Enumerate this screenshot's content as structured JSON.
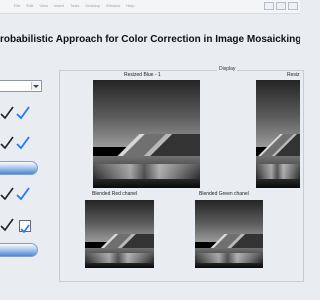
{
  "window": {
    "menu_items": [
      "File",
      "Edit",
      "View",
      "Insert",
      "Tools",
      "Desktop",
      "Window",
      "Help"
    ],
    "title": "robabilistic Approach for Color Correction in Image Mosaicking Applicatio"
  },
  "panel": {
    "display_label": "Display"
  },
  "images": {
    "resized_blue_label": "Resized Blue - 1",
    "resized_right_label": "Resiz",
    "blended_red_label": "Blended Red chanel",
    "blended_green_label": "Blended Green chanel"
  },
  "icons": {
    "check": "check-icon",
    "tick": "tick-icon",
    "pill": "pill-button-icon",
    "checkbox": "checkbox-icon"
  },
  "colors": {
    "background": "#e9ecf1",
    "accent_blue": "#4a88d7",
    "text_dark": "#111111"
  }
}
